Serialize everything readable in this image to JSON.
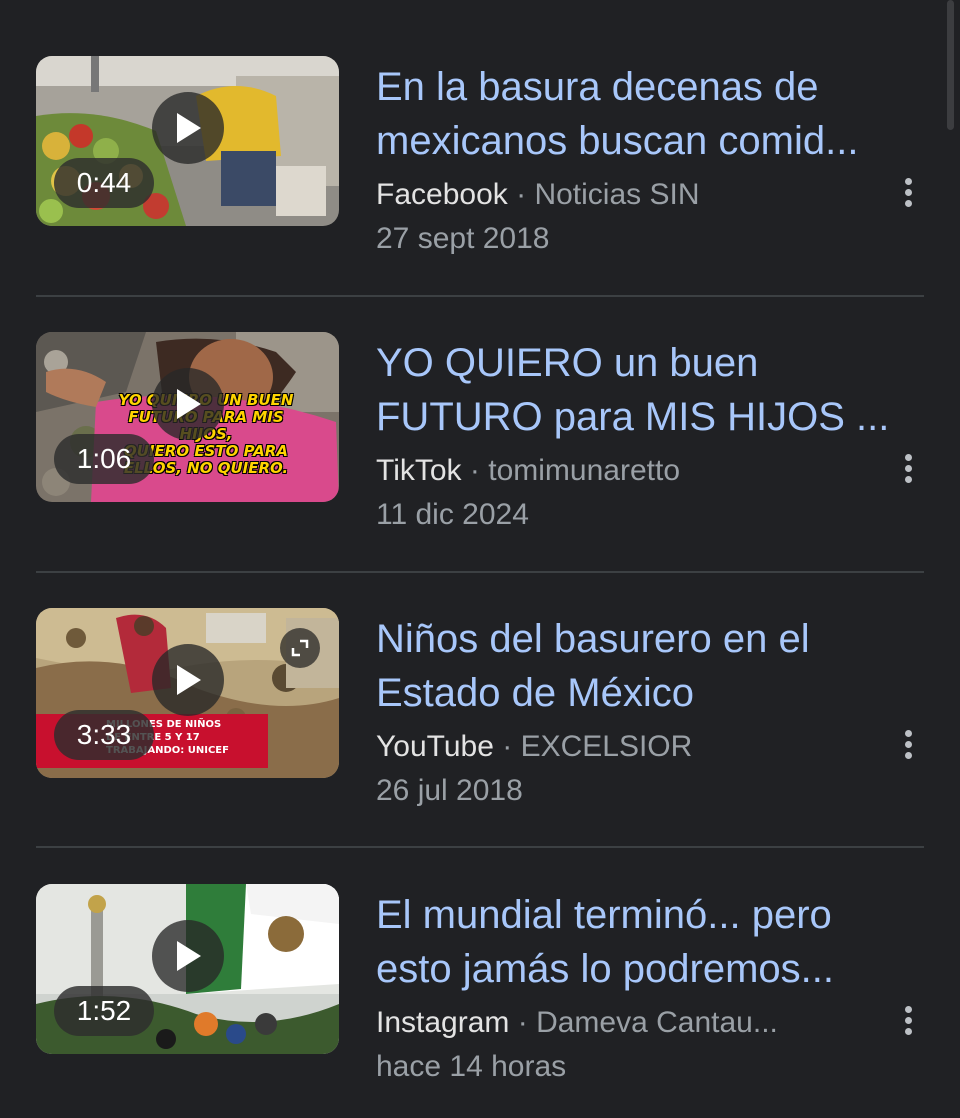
{
  "results": [
    {
      "title_line1": "En la basura decenas de",
      "title_line2": "mexicanos buscan comid...",
      "source": "Facebook",
      "separator": "·",
      "channel": "Noticias SIN",
      "date": "27 sept 2018",
      "duration": "0:44",
      "thumbnail_icon": "play-icon"
    },
    {
      "title_line1": "YO QUIERO un buen",
      "title_line2": "FUTURO para MIS HIJOS ...",
      "source": "TikTok",
      "separator": "·",
      "channel": "tomimunaretto",
      "date": "11 dic 2024",
      "duration": "1:06",
      "thumbnail_icon": "play-icon",
      "thumbnail_caption_line1": "YO QUIERO UN BUEN",
      "thumbnail_caption_line2": "FUTURO PARA MIS",
      "thumbnail_caption_line3": "HIJOS,",
      "thumbnail_caption_line4": "QUIERO ESTO PARA",
      "thumbnail_caption_line5": "ELLOS, NO QUIERO."
    },
    {
      "title_line1": "Niños del basurero en el",
      "title_line2": "Estado de México",
      "source": "YouTube",
      "separator": "·",
      "channel": "EXCELSIOR",
      "date": "26 jul 2018",
      "duration": "3:33",
      "thumbnail_icon": "play-icon",
      "thumbnail_banner_line1": "MILLONES DE NIÑOS",
      "thumbnail_banner_line2": "DE ENTRE 5 Y 17",
      "thumbnail_banner_line3": "TRABAJANDO: UNICEF"
    },
    {
      "title_line1": "El mundial terminó... pero",
      "title_line2": "esto jamás lo podremos...",
      "source": "Instagram",
      "separator": "·",
      "channel": "Dameva Cantau...",
      "date": "hace 14 horas",
      "duration": "1:52",
      "thumbnail_icon": "play-icon"
    }
  ],
  "colors": {
    "background": "#202124",
    "title": "#a8c7fa",
    "source": "#e3e3e3",
    "secondary": "#9aa0a6",
    "divider": "#3c4043"
  }
}
